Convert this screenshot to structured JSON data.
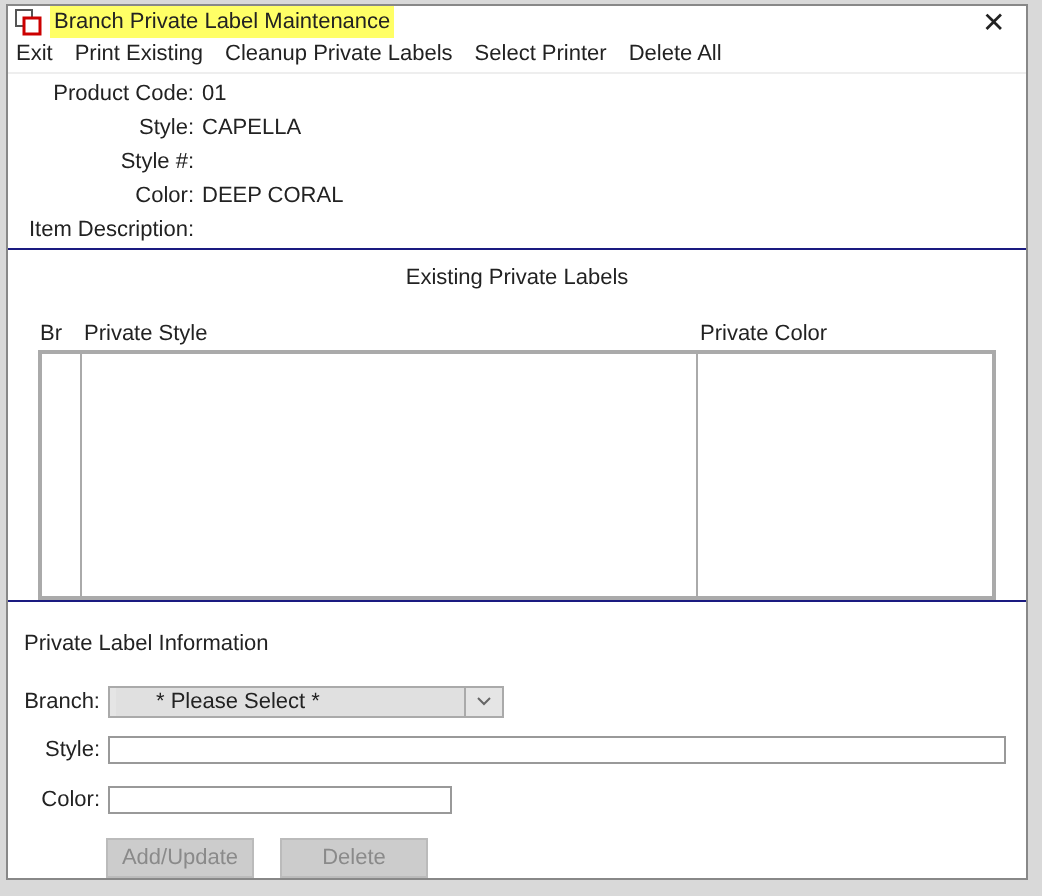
{
  "window": {
    "title": "Branch Private Label Maintenance",
    "close": "✕"
  },
  "menu": [
    {
      "label": "Exit"
    },
    {
      "label": "Print Existing"
    },
    {
      "label": "Cleanup Private Labels"
    },
    {
      "label": "Select Printer"
    },
    {
      "label": "Delete All"
    }
  ],
  "product_info": [
    {
      "label": "Product Code:",
      "value": "01"
    },
    {
      "label": "Style:",
      "value": "CAPELLA"
    },
    {
      "label": "Style #:"
    },
    {
      "label": "Color:",
      "value": "DEEP CORAL"
    },
    {
      "label": "Item Description:"
    }
  ],
  "existing_labels": {
    "title": "Existing Private Labels",
    "columns": [
      "Br",
      "Private Style",
      "Private Color"
    ]
  },
  "label_info": {
    "title": "Private Label Information",
    "fields": [
      {
        "kind": "dropdown",
        "label": "Branch:",
        "value": "* Please Select *"
      },
      {
        "kind": "text",
        "label": "Style:"
      },
      {
        "kind": "text",
        "label": "Color:"
      }
    ],
    "buttons": [
      {
        "label": "Add/Update",
        "disabled": true
      },
      {
        "label": "Delete",
        "disabled": true
      }
    ]
  }
}
